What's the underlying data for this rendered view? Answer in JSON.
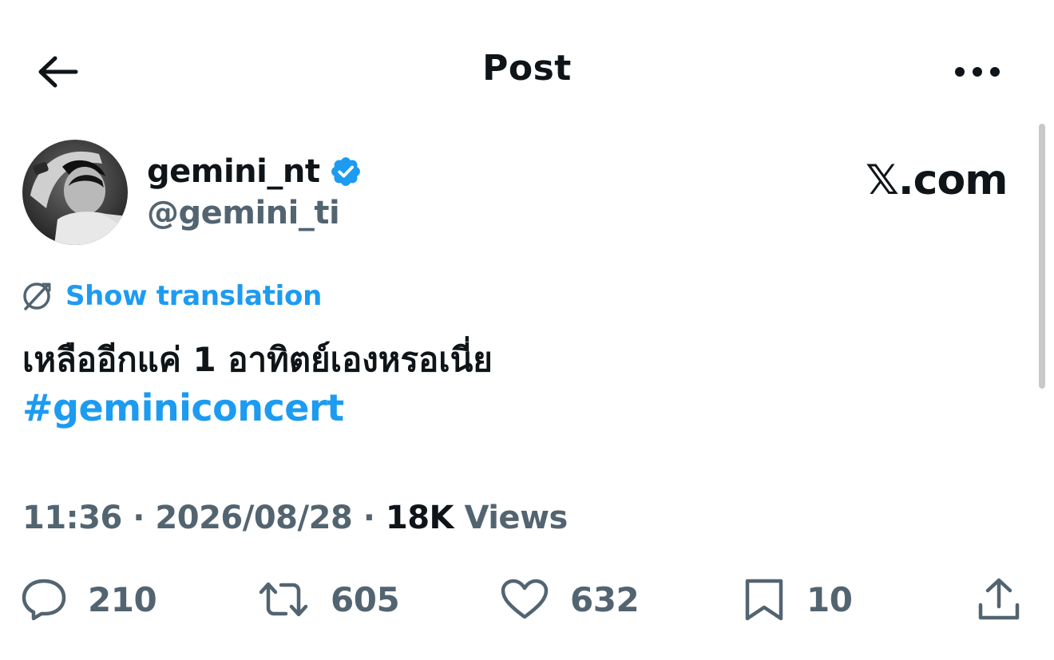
{
  "header": {
    "title": "Post",
    "back_icon": "arrow-left-icon",
    "more_icon": "more-horizontal-icon"
  },
  "author": {
    "display_name": "gemini_nt",
    "handle": "@gemini_ti",
    "verified": true,
    "verified_color": "#1d9bf0"
  },
  "brand": {
    "x_glyph": "𝕏",
    "domain_text": ".com"
  },
  "translation": {
    "label": "Show translation",
    "icon": "globe-icon"
  },
  "post": {
    "text": "เหลืออีกแค่ 1 อาทิตย์เองหรอเนี่ย",
    "hashtag": "#geminiconcert"
  },
  "meta": {
    "time": "11:36",
    "separator": "·",
    "date": "2026/08/28",
    "views_count": "18K",
    "views_label": "Views"
  },
  "actions": {
    "reply_count": "210",
    "repost_count": "605",
    "like_count": "632",
    "bookmark_count": "10"
  },
  "colors": {
    "accent": "#1d9bf0",
    "text_primary": "#0f1419",
    "text_secondary": "#536471",
    "background": "#ffffff"
  }
}
